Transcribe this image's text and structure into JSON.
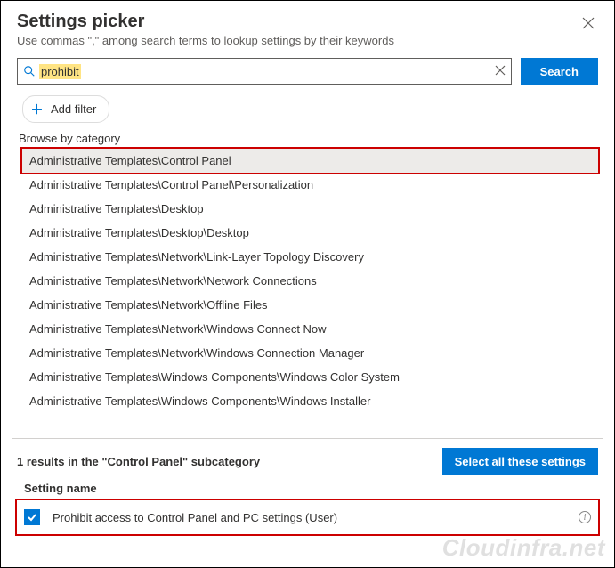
{
  "header": {
    "title": "Settings picker",
    "subtitle": "Use commas \",\" among search terms to lookup settings by their keywords"
  },
  "search": {
    "value": "prohibit",
    "button_label": "Search"
  },
  "add_filter_label": "Add filter",
  "browse_label": "Browse by category",
  "categories": [
    {
      "label": "Administrative Templates\\Control Panel",
      "selected": true
    },
    {
      "label": "Administrative Templates\\Control Panel\\Personalization",
      "selected": false
    },
    {
      "label": "Administrative Templates\\Desktop",
      "selected": false
    },
    {
      "label": "Administrative Templates\\Desktop\\Desktop",
      "selected": false
    },
    {
      "label": "Administrative Templates\\Network\\Link-Layer Topology Discovery",
      "selected": false
    },
    {
      "label": "Administrative Templates\\Network\\Network Connections",
      "selected": false
    },
    {
      "label": "Administrative Templates\\Network\\Offline Files",
      "selected": false
    },
    {
      "label": "Administrative Templates\\Network\\Windows Connect Now",
      "selected": false
    },
    {
      "label": "Administrative Templates\\Network\\Windows Connection Manager",
      "selected": false
    },
    {
      "label": "Administrative Templates\\Windows Components\\Windows Color System",
      "selected": false
    },
    {
      "label": "Administrative Templates\\Windows Components\\Windows Installer",
      "selected": false
    }
  ],
  "results": {
    "summary": "1 results in the \"Control Panel\" subcategory",
    "select_all_label": "Select all these settings",
    "column_header": "Setting name",
    "items": [
      {
        "label": "Prohibit access to Control Panel and PC settings (User)",
        "checked": true
      }
    ]
  },
  "watermark": "Cloudinfra.net"
}
